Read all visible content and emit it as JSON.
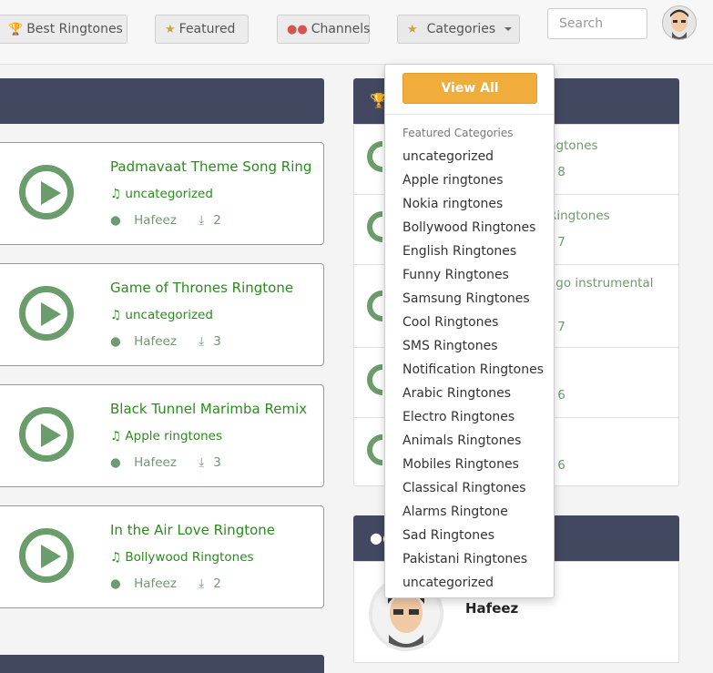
{
  "nav": {
    "best_label": "Best Ringtones",
    "featured_label": "Featured",
    "channels_label": "Channels",
    "categories_label": "Categories",
    "search_placeholder": "Search"
  },
  "ringtones": [
    {
      "title": "Padmavaat Theme Song Ringtone",
      "category": "uncategorized",
      "author": "Hafeez",
      "downloads": "2"
    },
    {
      "title": "Game of Thrones Ringtone",
      "category": "uncategorized",
      "author": "Hafeez",
      "downloads": "3"
    },
    {
      "title": "Black Tunnel Marimba Remix Ringtone",
      "category": "Apple ringtones",
      "author": "Hafeez",
      "downloads": "3"
    },
    {
      "title": "In the Air Love Ringtone",
      "category": "Bollywood Ringtones",
      "author": "Hafeez",
      "downloads": "2"
    }
  ],
  "right_list": [
    {
      "text": "ngtones",
      "count": "8"
    },
    {
      "text": "Ringtones",
      "count": "7"
    },
    {
      "text": "ago instrumental",
      "count": "7"
    },
    {
      "text": "s",
      "count": "6"
    },
    {
      "text": "",
      "count": "6"
    }
  ],
  "user_panel": {
    "name": "Hafeez"
  },
  "dropdown": {
    "view_all": "View All",
    "header": "Featured Categories",
    "items": [
      "uncategorized",
      "Apple ringtones",
      "Nokia ringtones",
      "Bollywood Ringtones",
      "English Ringtones",
      "Funny Ringtones",
      "Samsung Ringtones",
      "Cool Ringtones",
      "SMS Ringtones",
      "Notification Ringtones",
      "Arabic Ringtones",
      "Electro Ringtones",
      "Animals Ringtones",
      "Mobiles Ringtones",
      "Classical Ringtones",
      "Alarms Ringtone",
      "Sad Ringtones",
      "Pakistani Ringtones",
      "uncategorized"
    ]
  },
  "colors": {
    "accent": "#f0ad3b",
    "green": "#2b8a1e",
    "panel": "#414860"
  }
}
